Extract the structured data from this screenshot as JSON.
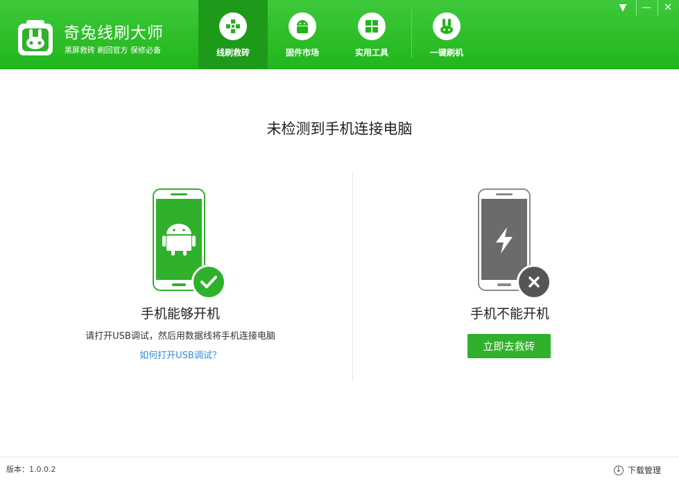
{
  "header": {
    "brand_title": "奇兔线刷大师",
    "brand_subtitle": "黑屏救砖 刷回官方 保修必备",
    "nav": [
      {
        "label": "线刷救砖",
        "icon": "plus-cross-icon",
        "active": true
      },
      {
        "label": "固件市场",
        "icon": "android-icon",
        "active": false
      },
      {
        "label": "实用工具",
        "icon": "grid-icon",
        "active": false
      },
      {
        "label": "一键刷机",
        "icon": "rabbit-icon",
        "active": false
      }
    ],
    "window_controls": {
      "menu": "▼",
      "minimize": "—",
      "close": "✕"
    }
  },
  "main": {
    "heading": "未检测到手机连接电脑",
    "left": {
      "caption": "手机能够开机",
      "description": "请打开USB调试，然后用数据线将手机连接电脑",
      "link": "如何打开USB调试？"
    },
    "right": {
      "caption": "手机不能开机",
      "button": "立即去救砖"
    }
  },
  "footer": {
    "version": "版本：1.0.0.2",
    "download_manager": "下载管理"
  },
  "colors": {
    "brand_green": "#21b51c",
    "active_tab": "#1e9a1a",
    "link_blue": "#2b8de0",
    "phone_off_gray": "#6b6b6b"
  }
}
